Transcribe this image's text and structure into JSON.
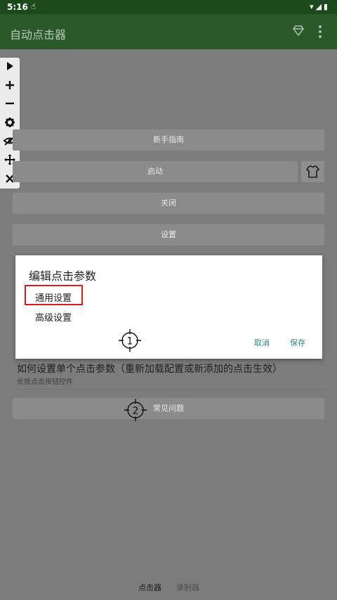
{
  "status_bar": {
    "time": "5:16"
  },
  "app_bar": {
    "title": "自动点击器"
  },
  "main": {
    "guide_label": "新手指南",
    "start_label": "启动",
    "close_label": "关闭",
    "settings_label": "设置",
    "faq_label": "常见问题",
    "help_title": "如何设置单个点击参数（重新加载配置或新添加的点击生效）",
    "help_sub": "长按点击按钮控件"
  },
  "dialog": {
    "title": "编辑点击参数",
    "option_general": "通用设置",
    "option_advanced": "高级设置",
    "cancel_label": "取消",
    "save_label": "保存"
  },
  "targets": [
    "1",
    "2"
  ],
  "bottom_nav": {
    "tab_clicker": "点击器",
    "tab_recorder": "录制器"
  },
  "colors": {
    "highlight": "#e01b1b",
    "accent": "#2b8a83",
    "appbar": "#2a5a2a"
  }
}
